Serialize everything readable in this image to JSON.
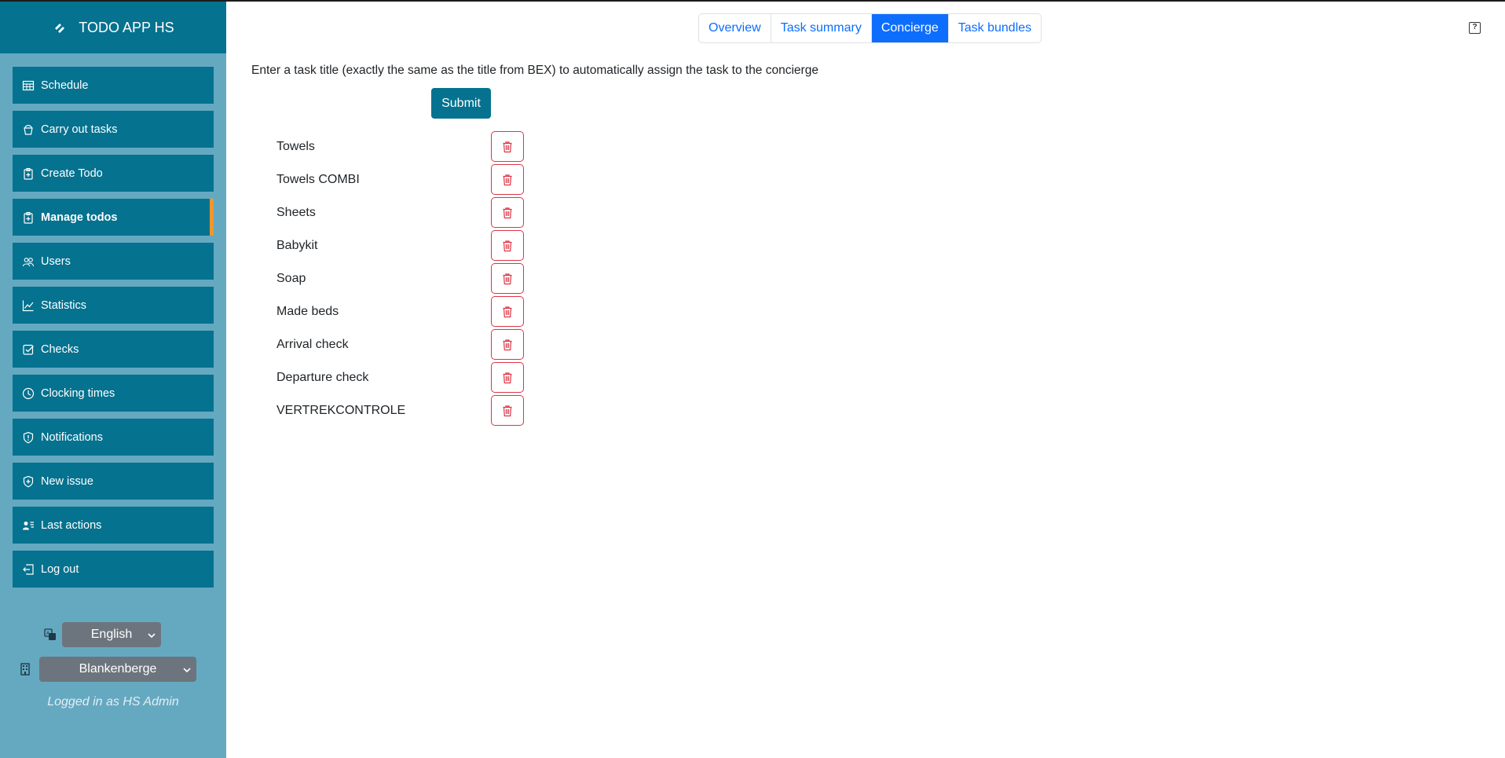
{
  "brand": {
    "title": "TODO APP HS",
    "icon": "app-logo-icon"
  },
  "nav": [
    {
      "label": "Schedule",
      "icon": "table-icon",
      "name": "schedule"
    },
    {
      "label": "Carry out tasks",
      "icon": "bucket-icon",
      "name": "carry-out-tasks"
    },
    {
      "label": "Create Todo",
      "icon": "clipboard-plus-icon",
      "name": "create-todo"
    },
    {
      "label": "Manage todos",
      "icon": "clipboard-check-icon",
      "name": "manage-todos",
      "active": true
    },
    {
      "label": "Users",
      "icon": "people-icon",
      "name": "users"
    },
    {
      "label": "Statistics",
      "icon": "graph-icon",
      "name": "statistics"
    },
    {
      "label": "Checks",
      "icon": "check-square-icon",
      "name": "checks"
    },
    {
      "label": "Clocking times",
      "icon": "clock-icon",
      "name": "clocking-times"
    },
    {
      "label": "Notifications",
      "icon": "shield-exclamation-icon",
      "name": "notifications"
    },
    {
      "label": "New issue",
      "icon": "shield-plus-icon",
      "name": "new-issue"
    },
    {
      "label": "Last actions",
      "icon": "person-lines-icon",
      "name": "last-actions"
    },
    {
      "label": "Log out",
      "icon": "box-arrow-left-icon",
      "name": "log-out"
    }
  ],
  "language": {
    "value": "English",
    "icon": "translate-icon"
  },
  "location": {
    "value": "Blankenberge",
    "icon": "building-icon"
  },
  "logged_in": "Logged in as HS Admin",
  "tabs": [
    {
      "label": "Overview",
      "active": false
    },
    {
      "label": "Task summary",
      "active": false
    },
    {
      "label": "Concierge",
      "active": true
    },
    {
      "label": "Task bundles",
      "active": false
    }
  ],
  "help_label": "?",
  "instruction": "Enter a task title (exactly the same as the title from BEX) to automatically assign the task to the concierge",
  "submit_label": "Submit",
  "tasks": [
    "Towels",
    "Towels COMBI",
    "Sheets",
    "Babykit",
    "Soap",
    "Made beds",
    "Arrival check",
    "Departure check",
    "VERTREKCONTROLE"
  ],
  "colors": {
    "primary": "#05728f",
    "sidebar": "#65a9c1",
    "accent": "#f0962c",
    "tab_active": "#0d6efd",
    "danger": "#dc3545"
  }
}
